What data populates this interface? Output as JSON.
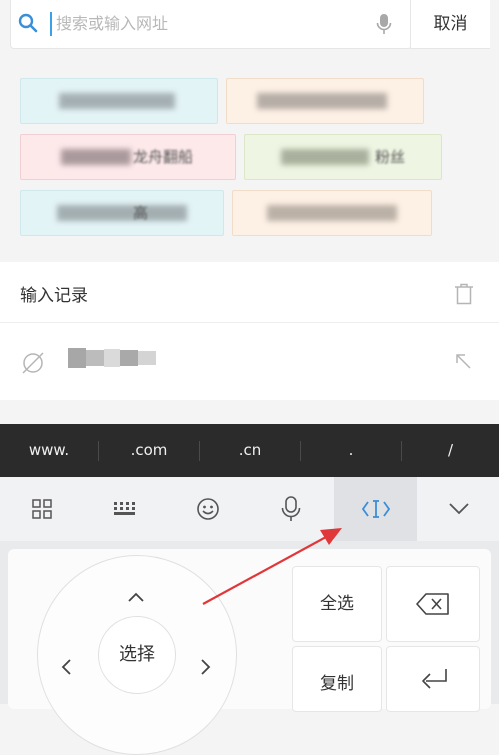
{
  "search": {
    "placeholder": "搜索或输入网址",
    "cancel_label": "取消"
  },
  "suggestions": [
    {
      "text": "",
      "bg": "#e3f4f6",
      "border": "#cfe8ec"
    },
    {
      "text": "",
      "bg": "#fdf0e4",
      "border": "#f1dcc8"
    },
    {
      "text": "龙舟翻船",
      "bg": "#fde8ea",
      "border": "#f2cfd4"
    },
    {
      "text": "粉丝",
      "bg": "#eef5e2",
      "border": "#dbe7c7"
    },
    {
      "text": "高",
      "bg": "#e3f4f6",
      "border": "#cfe8ec"
    },
    {
      "text": "",
      "bg": "#fdf0e4",
      "border": "#f1dcc8"
    }
  ],
  "history": {
    "title": "输入记录"
  },
  "url_shortcuts": [
    "www.",
    ".com",
    ".cn",
    ".",
    "/"
  ],
  "keyboard": {
    "select_label": "选择",
    "select_all_label": "全选",
    "copy_label": "复制"
  },
  "colors": {
    "accent": "#3a8fd8",
    "annotation_arrow": "#e0383a"
  }
}
